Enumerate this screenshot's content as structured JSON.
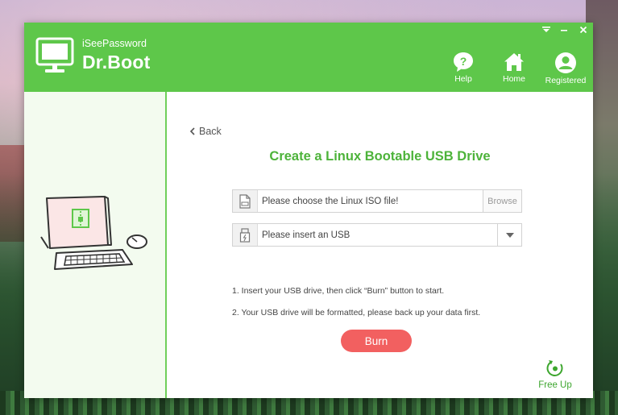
{
  "app": {
    "brand_sub": "iSeePassword",
    "brand_main": "Dr.Boot"
  },
  "nav": {
    "help": "Help",
    "home": "Home",
    "registered": "Registered"
  },
  "main": {
    "back": "Back",
    "title": "Create a Linux Bootable USB Drive",
    "iso_placeholder": "Please choose the Linux ISO file!",
    "browse": "Browse",
    "usb_placeholder": "Please insert an USB",
    "instruction_1": "1. Insert your USB drive, then click “Burn” button to start.",
    "instruction_2": "2. Your USB drive will be formatted, please back up your data first.",
    "burn": "Burn",
    "free_up": "Free Up"
  },
  "icons": {
    "logo": "monitor-icon",
    "help": "question-icon",
    "home": "house-icon",
    "registered": "user-icon",
    "iso": "file-icon",
    "usb": "usb-icon",
    "dropdown": "chevron-down-icon",
    "free_up": "refresh-icon"
  },
  "colors": {
    "brand_green": "#5ec74a",
    "title_green": "#4db33a",
    "burn_red": "#f26060"
  }
}
